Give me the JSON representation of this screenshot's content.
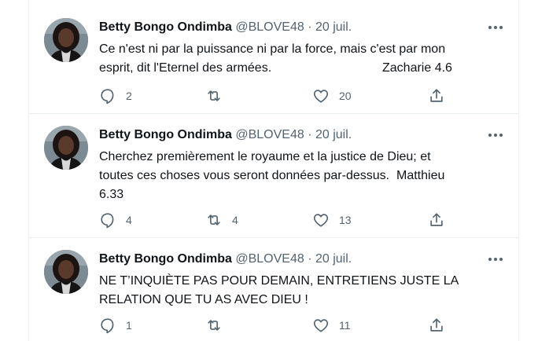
{
  "tweets": [
    {
      "author": "Betty Bongo Ondimba",
      "handle": "@BLOVE48",
      "separator": "·",
      "date": "20 juil.",
      "text_line1": "Ce n'est ni par la puissance ni par la force, mais c'est par mon",
      "text_line2": "esprit, dit l'Eternel des armées.",
      "reference": "Zacharie 4.6",
      "replies": "2",
      "retweets": "",
      "likes": "20"
    },
    {
      "author": "Betty Bongo Ondimba",
      "handle": "@BLOVE48",
      "separator": "·",
      "date": "20 juil.",
      "text_line1": "Cherchez premièrement le royaume et la justice de Dieu; et",
      "text_line2": "toutes ces choses vous seront données par-dessus.  Matthieu",
      "text_line3": "6.33",
      "replies": "4",
      "retweets": "4",
      "likes": "13"
    },
    {
      "author": "Betty Bongo Ondimba",
      "handle": "@BLOVE48",
      "separator": "·",
      "date": "20 juil.",
      "text_line1": "NE T’INQUIÈTE PAS POUR DEMAIN, ENTRETIENS JUSTE LA",
      "text_line2": "RELATION QUE TU AS AVEC DIEU !",
      "replies": "1",
      "retweets": "",
      "likes": "11"
    }
  ],
  "icons": {
    "reply": "speech-bubble-icon",
    "retweet": "retweet-arrows-icon",
    "like": "heart-outline-icon",
    "share": "share-upload-icon",
    "more": "three-dots-icon"
  },
  "colors": {
    "text": "#0f1419",
    "secondary": "#536471",
    "divider": "#eff3f4"
  }
}
